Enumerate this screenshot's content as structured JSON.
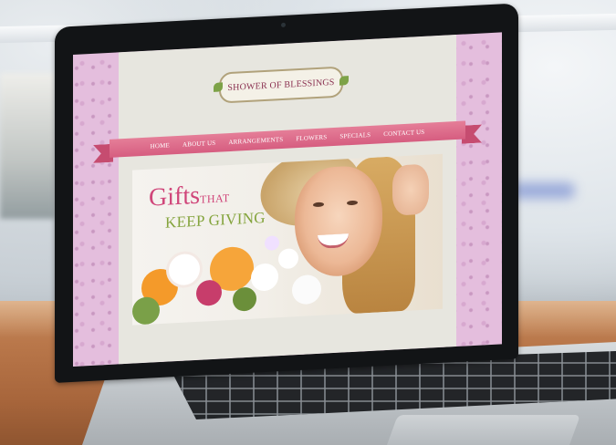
{
  "site": {
    "logo_text": "SHOWER OF BLESSINGS",
    "nav": [
      "HOME",
      "ABOUT US",
      "ARRANGEMENTS",
      "FLOWERS",
      "SPECIALS",
      "CONTACT US"
    ],
    "hero": {
      "title_big": "Gifts",
      "title_small": "THAT",
      "subtitle": "KEEP GIVING"
    }
  },
  "colors": {
    "pink_accent": "#d65d80",
    "title_pink": "#d0467a",
    "subtitle_green": "#84a43d",
    "pattern_pink": "#e4bedd"
  }
}
